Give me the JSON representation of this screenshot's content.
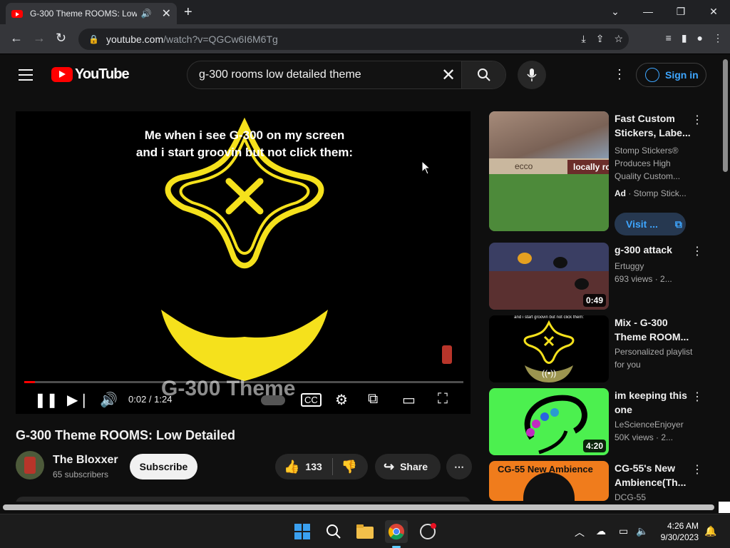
{
  "browser": {
    "tab_title": "G-300 Theme ROOMS: Low",
    "url_host": "youtube.com",
    "url_path": "/watch?v=QGCw6I6M6Tg"
  },
  "youtube": {
    "logo_text": "YouTube",
    "search_query": "g-300 rooms low detailed theme",
    "sign_in": "Sign in"
  },
  "player": {
    "overlay_text_line1": "Me when i see G-300 on my screen",
    "overlay_text_line2": "and i start groovin but not click them:",
    "watermark": "G-300 Theme",
    "time": "0:02 / 1:24",
    "progress": 0.024
  },
  "video": {
    "title": "G-300 Theme ROOMS: Low Detailed",
    "channel": "The Bloxxer",
    "subscribers": "65 subscribers",
    "subscribe_label": "Subscribe",
    "likes": "133",
    "share_label": "Share"
  },
  "sidebar": {
    "ad": {
      "title": "Fast Custom Stickers, Labe...",
      "desc": "Stomp Stickers® Produces High Quality Custom...",
      "ad_label": "Ad",
      "advertiser": "· Stomp Stick...",
      "visit_label": "Visit ...",
      "banner_left": "ecco",
      "banner_right": "locally ro"
    },
    "items": [
      {
        "title": "g-300 attack",
        "channel": "Ertuggy",
        "meta": "693 views · 2...",
        "duration": "0:49"
      },
      {
        "title": "Mix - G-300 Theme ROOM...",
        "channel": "Personalized playlist for you",
        "meta": "",
        "duration": "",
        "thumb_text": "and i start groovin but not click them:"
      },
      {
        "title": "im keeping this one",
        "channel": "LeScienceEnjoyer",
        "meta": "50K views · 2...",
        "duration": "4:20"
      },
      {
        "title": "CG-55's New Ambience(Th...",
        "channel": "DCG-55",
        "meta": "",
        "duration": "",
        "thumb_text": "CG-55 New Ambience"
      }
    ]
  },
  "taskbar": {
    "time": "4:26 AM",
    "date": "9/30/2023"
  },
  "colors": {
    "youtube_red": "#ff0000",
    "link_blue": "#3ea6ff",
    "yellow_shape": "#f5e11c"
  }
}
